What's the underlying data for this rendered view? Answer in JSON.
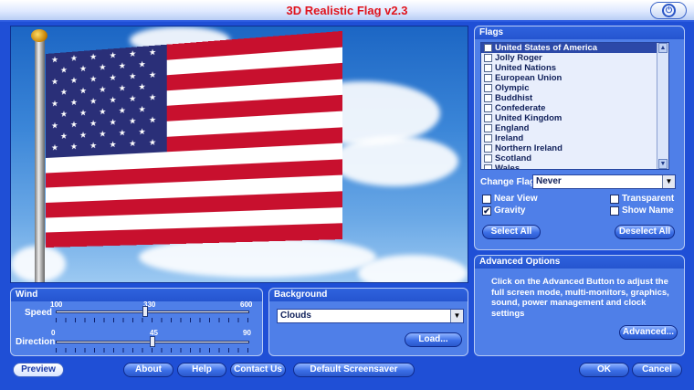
{
  "window": {
    "title": "3D Realistic Flag v2.3"
  },
  "flags_panel": {
    "title": "Flags",
    "items": [
      {
        "label": "United States of America",
        "checked": false,
        "selected": true
      },
      {
        "label": "Jolly Roger",
        "checked": false,
        "selected": false
      },
      {
        "label": "United Nations",
        "checked": false,
        "selected": false
      },
      {
        "label": "European Union",
        "checked": false,
        "selected": false
      },
      {
        "label": "Olympic",
        "checked": false,
        "selected": false
      },
      {
        "label": "Buddhist",
        "checked": false,
        "selected": false
      },
      {
        "label": "Confederate",
        "checked": false,
        "selected": false
      },
      {
        "label": "United Kingdom",
        "checked": false,
        "selected": false
      },
      {
        "label": "England",
        "checked": false,
        "selected": false
      },
      {
        "label": "Ireland",
        "checked": false,
        "selected": false
      },
      {
        "label": "Northern Ireland",
        "checked": false,
        "selected": false
      },
      {
        "label": "Scotland",
        "checked": false,
        "selected": false
      },
      {
        "label": "Wales",
        "checked": false,
        "selected": false
      }
    ],
    "change_flag_label": "Change Flag",
    "change_flag_value": "Never",
    "near_view_label": "Near View",
    "gravity_label": "Gravity",
    "transparent_label": "Transparent",
    "show_name_label": "Show Name",
    "near_view_checked": false,
    "gravity_checked": true,
    "transparent_checked": false,
    "show_name_checked": false,
    "select_all_label": "Select All",
    "deselect_all_label": "Deselect All"
  },
  "advanced_panel": {
    "title": "Advanced Options",
    "text": "Click on the Advanced Button to adjust the full screen mode, multi-monitors, graphics, sound, power management and clock settings",
    "button_label": "Advanced..."
  },
  "wind_panel": {
    "title": "Wind",
    "speed_label": "Speed",
    "speed_min": "100",
    "speed_value": "330",
    "speed_max": "600",
    "speed_fraction": 0.46,
    "direction_label": "Direction",
    "direction_min": "0",
    "direction_value": "45",
    "direction_max": "90",
    "direction_fraction": 0.5
  },
  "background_panel": {
    "title": "Background",
    "value": "Clouds",
    "load_label": "Load..."
  },
  "footer": {
    "preview_label": "Preview",
    "about_label": "About",
    "help_label": "Help",
    "contact_label": "Contact Us",
    "default_label": "Default Screensaver",
    "ok_label": "OK",
    "cancel_label": "Cancel"
  }
}
